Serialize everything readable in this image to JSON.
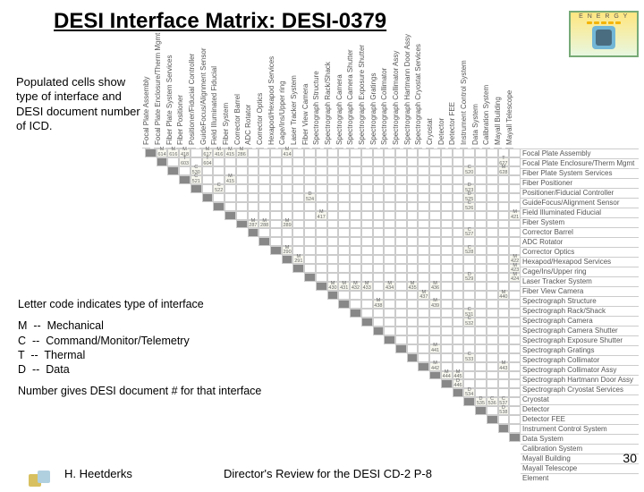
{
  "title": "DESI Interface Matrix: DESI-0379",
  "description": "Populated cells show type of interface and DESI document number of ICD.",
  "legend": {
    "intro": "Letter code indicates type of interface",
    "codes_text": "M  --  Mechanical\nC  --  Command/Monitor/Telemetry\nT  --  Thermal\nD  --  Data",
    "codes": [
      {
        "letter": "M",
        "meaning": "Mechanical"
      },
      {
        "letter": "C",
        "meaning": "Command/Monitor/Telemetry"
      },
      {
        "letter": "T",
        "meaning": "Thermal"
      },
      {
        "letter": "D",
        "meaning": "Data"
      }
    ],
    "numbernote": "Number gives DESI document # for that interface"
  },
  "footer": {
    "left": "H. Heetderks",
    "center": "Director's Review for the DESI  CD-2   P-8"
  },
  "page_number": "30",
  "logo_text": "E N E R G Y",
  "elements": [
    "Focal Plate Assembly",
    "Focal Plate Enclosure/Therm Mgmt",
    "Fiber Plate System Services",
    "Fiber Positioner",
    "Positioner/Fiducial Controller",
    "GuideFocus/Alignment Sensor",
    "Field Illuminated Fiducial",
    "Fiber System",
    "Corrector Barrel",
    "ADC Rotator",
    "Corrector Optics",
    "Hexapod/Hexapod Services",
    "Cage/Ins/Upper ring",
    "Laser Tracker System",
    "Fiber View Camera",
    "Spectrograph Structure",
    "Spectrograph Rack/Shack",
    "Spectrograph Camera",
    "Spectrograph Camera Shutter",
    "Spectrograph Exposure Shutter",
    "Spectrograph Gratings",
    "Spectrograph Collimator",
    "Spectrograph Collimator Assy",
    "Spectrograph Hartmann Door Assy",
    "Spectrograph Cryostat Services",
    "Cryostat",
    "Detector",
    "Detector FEE",
    "Instrument Control System",
    "Data System",
    "Calibration System",
    "Mayall Building",
    "Mayall Telescope",
    "Element"
  ],
  "populated_cells": [
    {
      "r": 0,
      "c": 1,
      "code": "M",
      "num": "614"
    },
    {
      "r": 0,
      "c": 2,
      "code": "M",
      "num": "616"
    },
    {
      "r": 0,
      "c": 3,
      "code": "M",
      "num": "418"
    },
    {
      "r": 0,
      "c": 5,
      "code": "M",
      "num": "617"
    },
    {
      "r": 0,
      "c": 6,
      "code": "M",
      "num": "416"
    },
    {
      "r": 0,
      "c": 7,
      "code": "M",
      "num": "415"
    },
    {
      "r": 0,
      "c": 8,
      "code": "M",
      "num": "286"
    },
    {
      "r": 0,
      "c": 12,
      "code": "M",
      "num": "414"
    },
    {
      "r": 1,
      "c": 3,
      "code": "T",
      "num": "603"
    },
    {
      "r": 1,
      "c": 5,
      "code": "T",
      "num": "604"
    },
    {
      "r": 1,
      "c": 31,
      "code": "T",
      "num": "627"
    },
    {
      "r": 2,
      "c": 4,
      "code": "C",
      "num": "530"
    },
    {
      "r": 2,
      "c": 28,
      "code": "C",
      "num": "520"
    },
    {
      "r": 2,
      "c": 31,
      "code": "M",
      "num": "628"
    },
    {
      "r": 3,
      "c": 4,
      "code": "C",
      "num": "521"
    },
    {
      "r": 3,
      "c": 7,
      "code": "M",
      "num": "415"
    },
    {
      "r": 4,
      "c": 6,
      "code": "C",
      "num": "522"
    },
    {
      "r": 4,
      "c": 28,
      "code": "D",
      "num": "523"
    },
    {
      "r": 5,
      "c": 14,
      "code": "D",
      "num": "524"
    },
    {
      "r": 5,
      "c": 28,
      "code": "D",
      "num": "525"
    },
    {
      "r": 6,
      "c": 28,
      "code": "C",
      "num": "526"
    },
    {
      "r": 7,
      "c": 15,
      "code": "M",
      "num": "417"
    },
    {
      "r": 7,
      "c": 32,
      "code": "M",
      "num": "421"
    },
    {
      "r": 8,
      "c": 9,
      "code": "M",
      "num": "287"
    },
    {
      "r": 8,
      "c": 10,
      "code": "M",
      "num": "288"
    },
    {
      "r": 8,
      "c": 12,
      "code": "M",
      "num": "289"
    },
    {
      "r": 9,
      "c": 28,
      "code": "C",
      "num": "527"
    },
    {
      "r": 11,
      "c": 12,
      "code": "M",
      "num": "290"
    },
    {
      "r": 11,
      "c": 28,
      "code": "C",
      "num": "528"
    },
    {
      "r": 12,
      "c": 13,
      "code": "M",
      "num": "291"
    },
    {
      "r": 12,
      "c": 32,
      "code": "M",
      "num": "422"
    },
    {
      "r": 13,
      "c": 32,
      "code": "M",
      "num": "423"
    },
    {
      "r": 14,
      "c": 28,
      "code": "D",
      "num": "529"
    },
    {
      "r": 14,
      "c": 32,
      "code": "M",
      "num": "424"
    },
    {
      "r": 15,
      "c": 16,
      "code": "M",
      "num": "430"
    },
    {
      "r": 15,
      "c": 17,
      "code": "M",
      "num": "431"
    },
    {
      "r": 15,
      "c": 18,
      "code": "M",
      "num": "432"
    },
    {
      "r": 15,
      "c": 19,
      "code": "M",
      "num": "433"
    },
    {
      "r": 15,
      "c": 21,
      "code": "M",
      "num": "434"
    },
    {
      "r": 15,
      "c": 23,
      "code": "M",
      "num": "435"
    },
    {
      "r": 15,
      "c": 25,
      "code": "M",
      "num": "436"
    },
    {
      "r": 16,
      "c": 24,
      "code": "M",
      "num": "437"
    },
    {
      "r": 16,
      "c": 31,
      "code": "M",
      "num": "440"
    },
    {
      "r": 17,
      "c": 20,
      "code": "M",
      "num": "438"
    },
    {
      "r": 17,
      "c": 25,
      "code": "M",
      "num": "439"
    },
    {
      "r": 18,
      "c": 28,
      "code": "C",
      "num": "531"
    },
    {
      "r": 19,
      "c": 28,
      "code": "C",
      "num": "532"
    },
    {
      "r": 22,
      "c": 25,
      "code": "M",
      "num": "441"
    },
    {
      "r": 23,
      "c": 28,
      "code": "C",
      "num": "533"
    },
    {
      "r": 24,
      "c": 25,
      "code": "M",
      "num": "442"
    },
    {
      "r": 24,
      "c": 31,
      "code": "M",
      "num": "443"
    },
    {
      "r": 25,
      "c": 26,
      "code": "M",
      "num": "444"
    },
    {
      "r": 25,
      "c": 27,
      "code": "M",
      "num": "445"
    },
    {
      "r": 26,
      "c": 27,
      "code": "D",
      "num": "446"
    },
    {
      "r": 27,
      "c": 28,
      "code": "D",
      "num": "534"
    },
    {
      "r": 28,
      "c": 29,
      "code": "D",
      "num": "535"
    },
    {
      "r": 28,
      "c": 30,
      "code": "C",
      "num": "536"
    },
    {
      "r": 28,
      "c": 31,
      "code": "C",
      "num": "537"
    },
    {
      "r": 29,
      "c": 31,
      "code": "D",
      "num": "538"
    }
  ]
}
